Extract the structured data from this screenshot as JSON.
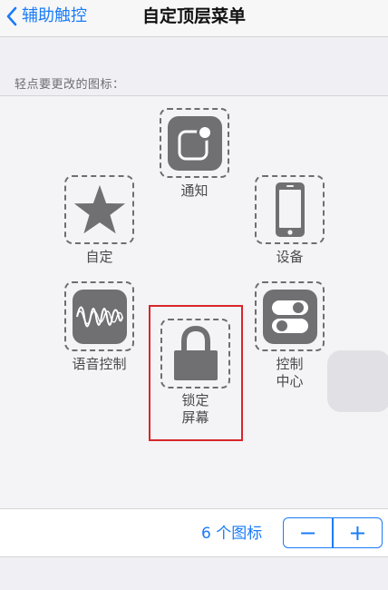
{
  "nav": {
    "back_label": "辅助触控",
    "title": "自定顶层菜单"
  },
  "section_header": "轻点要更改的图标：",
  "icons": {
    "notification": {
      "label": "通知"
    },
    "custom": {
      "label": "自定"
    },
    "device": {
      "label": "设备"
    },
    "voice_control": {
      "label": "语音控制"
    },
    "lock_screen": {
      "label_line1": "锁定",
      "label_line2": "屏幕"
    },
    "control_center": {
      "label_line1": "控制",
      "label_line2": "中心"
    }
  },
  "footer": {
    "count_label": "6 个图标",
    "minus": "−",
    "plus": "+"
  },
  "colors": {
    "accent": "#1a7cf7",
    "highlight": "#d8262b",
    "icon_tile": "#707073"
  }
}
